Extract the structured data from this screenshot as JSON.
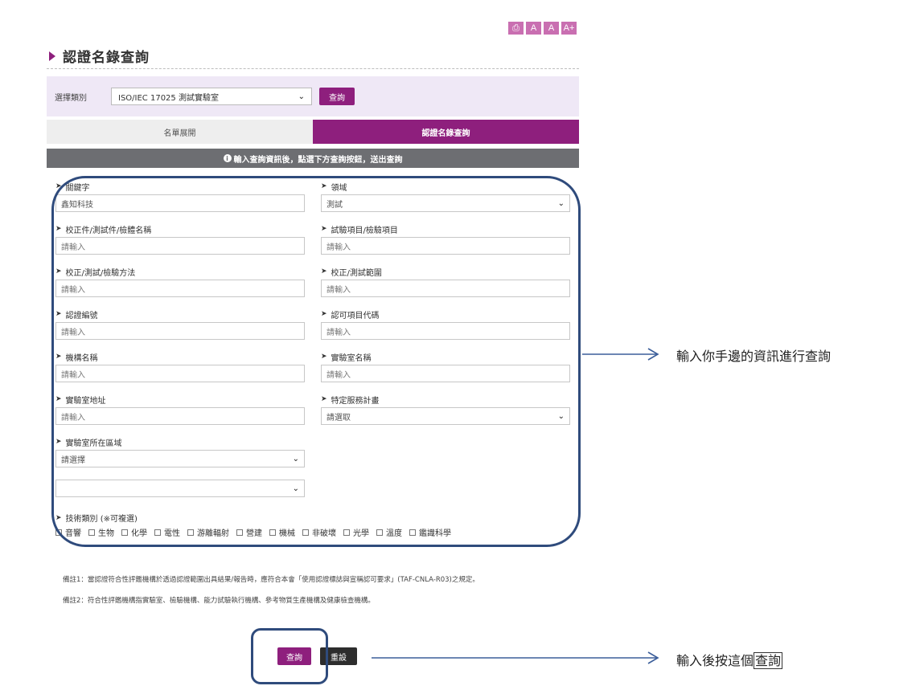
{
  "toolbar": {
    "tools": [
      {
        "icon": "print-icon",
        "label": "⎙"
      },
      {
        "icon": "font-small-icon",
        "label": "A"
      },
      {
        "icon": "font-medium-icon",
        "label": "A"
      },
      {
        "icon": "font-large-icon",
        "label": "A+"
      }
    ]
  },
  "page": {
    "title": "認證名錄查詢"
  },
  "category": {
    "label": "選擇類別",
    "selected": "ISO/IEC 17025 測試實驗室",
    "query_label": "查詢"
  },
  "tabs": [
    {
      "label": "名單展開",
      "active": false
    },
    {
      "label": "認證名錄查詢",
      "active": true
    }
  ],
  "notice": "輸入查詢資訊後，點選下方查詢按鈕，送出查詢",
  "form": {
    "keyword": {
      "label": "關鍵字",
      "value": "鑫知科技"
    },
    "domain": {
      "label": "領域",
      "value": "測試"
    },
    "item_name": {
      "label": "校正件/測試件/檢體名稱",
      "placeholder": "請輸入"
    },
    "test_item": {
      "label": "試驗項目/檢驗項目",
      "placeholder": "請輸入"
    },
    "method": {
      "label": "校正/測試/檢驗方法",
      "placeholder": "請輸入"
    },
    "range": {
      "label": "校正/測試範圍",
      "placeholder": "請輸入"
    },
    "cert_no": {
      "label": "認證編號",
      "placeholder": "請輸入"
    },
    "item_code": {
      "label": "認可項目代碼",
      "placeholder": "請輸入"
    },
    "org_name": {
      "label": "機構名稱",
      "placeholder": "請輸入"
    },
    "lab_name": {
      "label": "實驗室名稱",
      "placeholder": "請輸入"
    },
    "lab_address": {
      "label": "實驗室地址",
      "placeholder": "請輸入"
    },
    "program": {
      "label": "特定服務計畫",
      "value": "請選取"
    },
    "region": {
      "label": "實驗室所在區域",
      "value": "請選擇"
    },
    "sub_region": {
      "value": ""
    },
    "tech": {
      "label": "技術類別 (※可複選)",
      "options": [
        "音響",
        "生物",
        "化學",
        "電性",
        "游離輻射",
        "營建",
        "機械",
        "非破壞",
        "光學",
        "溫度",
        "鑑識科學"
      ]
    }
  },
  "notes": [
    "備註1：當認證符合性評鑑機構於透過認證範圍出具結果/報告時，應符合本會「使用認證標誌與宣稱認可要求」(TAF-CNLA-R03)之規定。",
    "備註2：符合性評鑑機構指實驗室、檢驗機構、能力試驗執行機構、參考物質生產機構及健康檢查機構。"
  ],
  "buttons": {
    "query": "查詢",
    "reset": "重設"
  },
  "annotations": {
    "note1": "輸入你手邊的資訊進行查詢",
    "note2_prefix": "輸入後按這個",
    "note2_boxed": "查詢"
  },
  "colors": {
    "brand": "#8e1f7d",
    "annotation": "#2f4b7c"
  }
}
